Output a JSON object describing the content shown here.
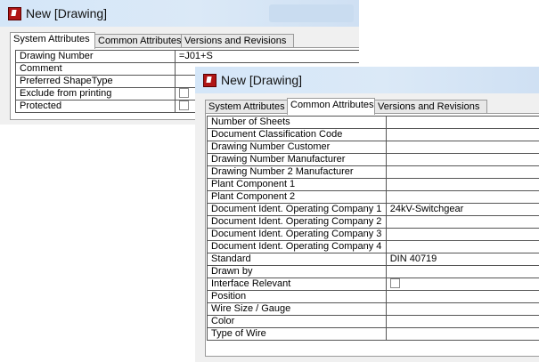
{
  "back_window": {
    "title": "New [Drawing]",
    "tabs": [
      "System Attributes",
      "Common Attributes",
      "Versions and Revisions"
    ],
    "active_tab": "System Attributes",
    "rows": [
      {
        "label": "Drawing Number",
        "value": "=J01+S"
      },
      {
        "label": "Comment",
        "value": ""
      },
      {
        "label": "Preferred ShapeType",
        "value": ""
      },
      {
        "label": "Exclude from printing",
        "checkbox": true,
        "checked": false
      },
      {
        "label": "Protected",
        "checkbox": true,
        "checked": false
      }
    ]
  },
  "front_window": {
    "title": "New [Drawing]",
    "tabs": [
      "System Attributes",
      "Common Attributes",
      "Versions and Revisions"
    ],
    "active_tab": "Common Attributes",
    "rows": [
      {
        "label": "Number of Sheets",
        "value": ""
      },
      {
        "label": "Document Classification Code",
        "value": ""
      },
      {
        "label": "Drawing Number Customer",
        "value": ""
      },
      {
        "label": "Drawing Number Manufacturer",
        "value": ""
      },
      {
        "label": "Drawing Number 2 Manufacturer",
        "value": ""
      },
      {
        "label": "Plant Component 1",
        "value": ""
      },
      {
        "label": "Plant Component 2",
        "value": ""
      },
      {
        "label": "Document Ident. Operating Company 1",
        "value": "24kV-Switchgear"
      },
      {
        "label": "Document Ident. Operating Company 2",
        "value": ""
      },
      {
        "label": "Document Ident. Operating Company 3",
        "value": ""
      },
      {
        "label": "Document Ident. Operating Company 4",
        "value": ""
      },
      {
        "label": "Standard",
        "value": "DIN 40719"
      },
      {
        "label": "Drawn by",
        "value": ""
      },
      {
        "label": "Interface Relevant",
        "checkbox": true,
        "checked": false
      },
      {
        "label": "Position",
        "value": ""
      },
      {
        "label": "Wire Size / Gauge",
        "value": ""
      },
      {
        "label": "Color",
        "value": ""
      },
      {
        "label": "Type of Wire",
        "value": ""
      }
    ]
  },
  "icons": {
    "window": "app-window-icon",
    "checkbox": "checkbox-icon"
  }
}
